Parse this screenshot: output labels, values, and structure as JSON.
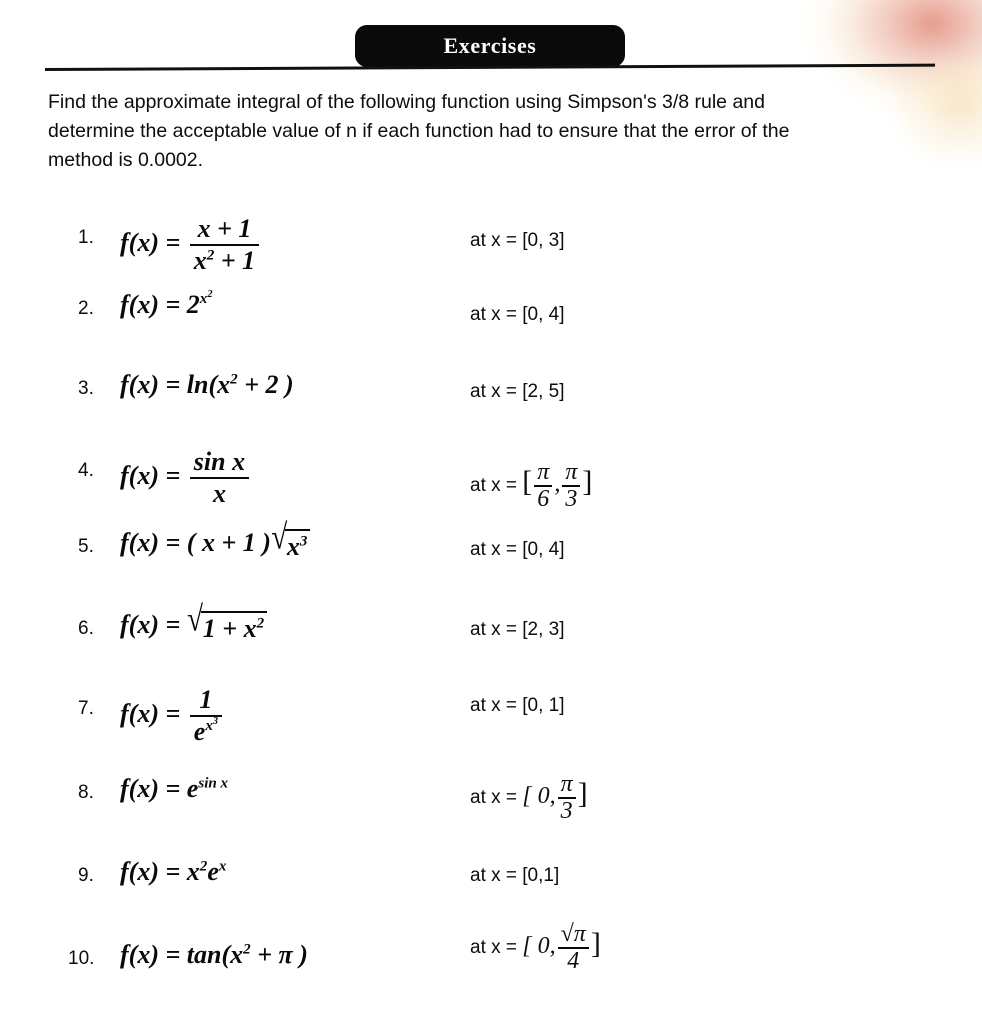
{
  "page": {
    "header_title": "Exercises",
    "accent_color": "#0a0a0a",
    "paper_color": "#ffffff",
    "smudge_color": "#e28a78"
  },
  "instructions": {
    "line1": "Find the approximate integral of the following function using Simpson's 3/8 rule and",
    "line2": "determine the acceptable value of n if each function had to ensure that the error of the",
    "line3": "method is 0.0002."
  },
  "problems": [
    {
      "number": "1.",
      "function_label": "f(x) =",
      "expression_text": "f(x) = (x + 1) / (x^2 + 1)",
      "numerator": "x + 1",
      "denominator_base": "x",
      "denominator_exp": "2",
      "denominator_tail": "+ 1",
      "interval_label": "at x =",
      "interval_text": "[0, 3]"
    },
    {
      "number": "2.",
      "function_label": "f(x) =",
      "expression_text": "f(x) = 2^(x^2)",
      "base": "2",
      "exp_base": "x",
      "exp_exp": "2",
      "interval_label": "at x =",
      "interval_text": "[0, 4]"
    },
    {
      "number": "3.",
      "function_label": "f(x) =",
      "expression_text": "f(x) = ln(x^2 + 2)",
      "fn_name": "ln(",
      "arg_base": "x",
      "arg_exp": "2",
      "arg_tail": "+ 2 )",
      "interval_label": "at x =",
      "interval_text": "[2, 5]"
    },
    {
      "number": "4.",
      "function_label": "f(x) =",
      "expression_text": "f(x) = sin x / x",
      "numerator": "sin x",
      "denominator": "x",
      "interval_label": "at x =",
      "interval_numerator_1": "π",
      "interval_denominator_1": "6",
      "interval_numerator_2": "π",
      "interval_denominator_2": "3"
    },
    {
      "number": "5.",
      "function_label": "f(x) =",
      "expression_text": "f(x) = (x + 1) sqrt(x^3)",
      "prefix": "( x + 1 )",
      "rad_base": "x",
      "rad_exp": "3",
      "interval_label": "at x =",
      "interval_text": "[0, 4]"
    },
    {
      "number": "6.",
      "function_label": "f(x) =",
      "expression_text": "f(x) = sqrt(1 + x^2)",
      "rad_lead": "1 + x",
      "rad_exp": "2",
      "interval_label": "at x =",
      "interval_text": "[2, 3]"
    },
    {
      "number": "7.",
      "function_label": "f(x) =",
      "expression_text": "f(x) = 1 / e^(x^3)",
      "numerator": "1",
      "denominator_base": "e",
      "denominator_exp_base": "x",
      "denominator_exp_exp": "3",
      "interval_label": "at x =",
      "interval_text": "[0, 1]"
    },
    {
      "number": "8.",
      "function_label": "f(x) =",
      "expression_text": "f(x) = e^(sin x)",
      "base": "e",
      "exponent": "sin x",
      "interval_label": "at x =",
      "interval_open": "[ 0,",
      "interval_numerator": "π",
      "interval_denominator": "3",
      "interval_close": "]"
    },
    {
      "number": "9.",
      "function_label": "f(x) =",
      "expression_text": "f(x) = x^2 e^x",
      "base1": "x",
      "exp1": "2",
      "base2": "e",
      "exp2": "x",
      "interval_label": "at x =",
      "interval_text": "[0,1]"
    },
    {
      "number": "10.",
      "function_label": "f(x) =",
      "expression_text": "f(x) = tan(x^2 + π)",
      "fn_name": "tan(",
      "arg_base": "x",
      "arg_exp": "2",
      "arg_tail": "+ π )",
      "interval_label": "at x =",
      "interval_open": "[ 0,",
      "interval_numerator": "√π",
      "interval_denominator": "4",
      "interval_close": "]"
    }
  ]
}
